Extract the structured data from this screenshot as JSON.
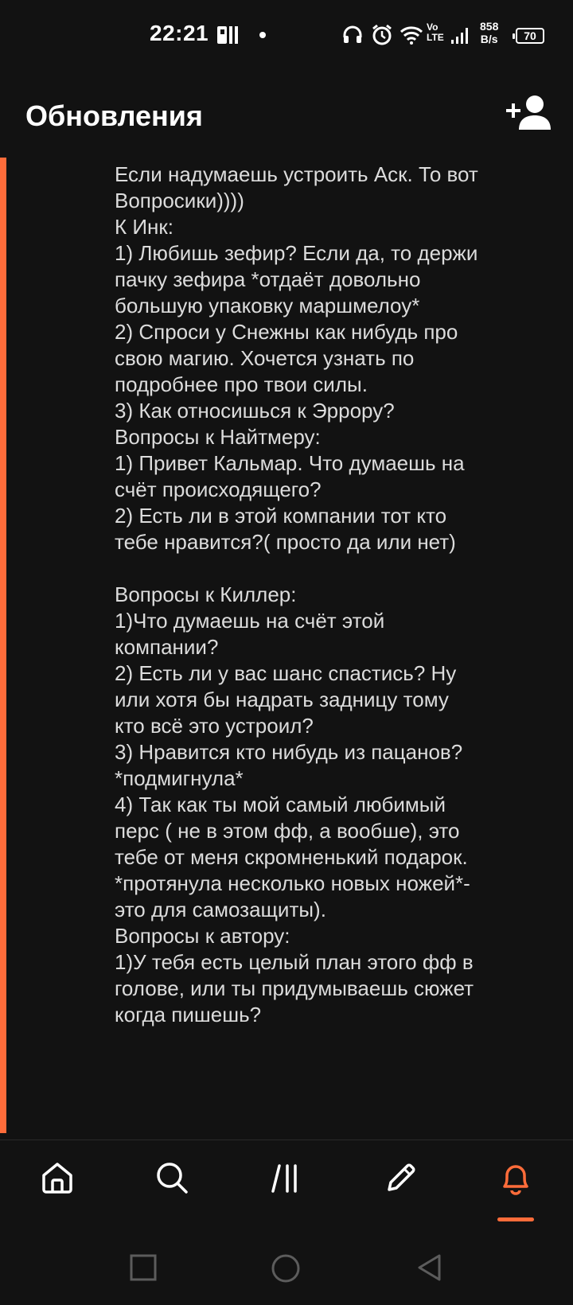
{
  "status_bar": {
    "time": "22:21",
    "net_speed_value": "858",
    "net_speed_unit": "B/s",
    "battery": "70",
    "icons": [
      "app-notification-icon",
      "headphones-icon",
      "alarm-icon",
      "wifi-icon",
      "volte-icon",
      "signal-icon",
      "battery-icon"
    ]
  },
  "header": {
    "title": "Обновления",
    "add_user_icon": "add-user-icon"
  },
  "message": {
    "text": "Если надумаешь устроить Аск. То вот Вопросики))))\nК Инк:\n1) Любишь зефир? Если да, то держи пачку зефира *отдаёт довольно большую упаковку маршмелоу*\n2) Спроси у Снежны как нибудь про свою магию. Хочется узнать по подробнее про твои силы.\n3) Как относишься к Эррору?\nВопросы к Найтмеру:\n1) Привет Кальмар. Что думаешь на счёт происходящего?\n2) Есть ли в этой компании тот кто тебе нравится?( просто да или нет)\n\nВопросы к Киллер:\n1)Что думаешь на счёт этой компании?\n2) Есть ли у вас шанс спастись? Ну или хотя бы надрать задницу тому кто всё это устроил?\n3) Нравится кто нибудь из пацанов? *подмигнула*\n4) Так как ты мой самый любимый перс ( не в этом фф, а вообше), это тебе от меня скромненький подарок. *протянула несколько новых ножей*- это для самозащиты).\nВопросы к автору:\n1)У тебя есть целый план этого фф в голове, или ты придумываешь сюжет когда пишешь?"
  },
  "bottom_nav": {
    "items": [
      "home-icon",
      "search-icon",
      "library-icon",
      "write-icon",
      "notifications-icon"
    ],
    "active": "notifications-icon"
  },
  "colors": {
    "accent": "#ff6c3a",
    "background": "#121212",
    "text": "#dcdcdc"
  }
}
